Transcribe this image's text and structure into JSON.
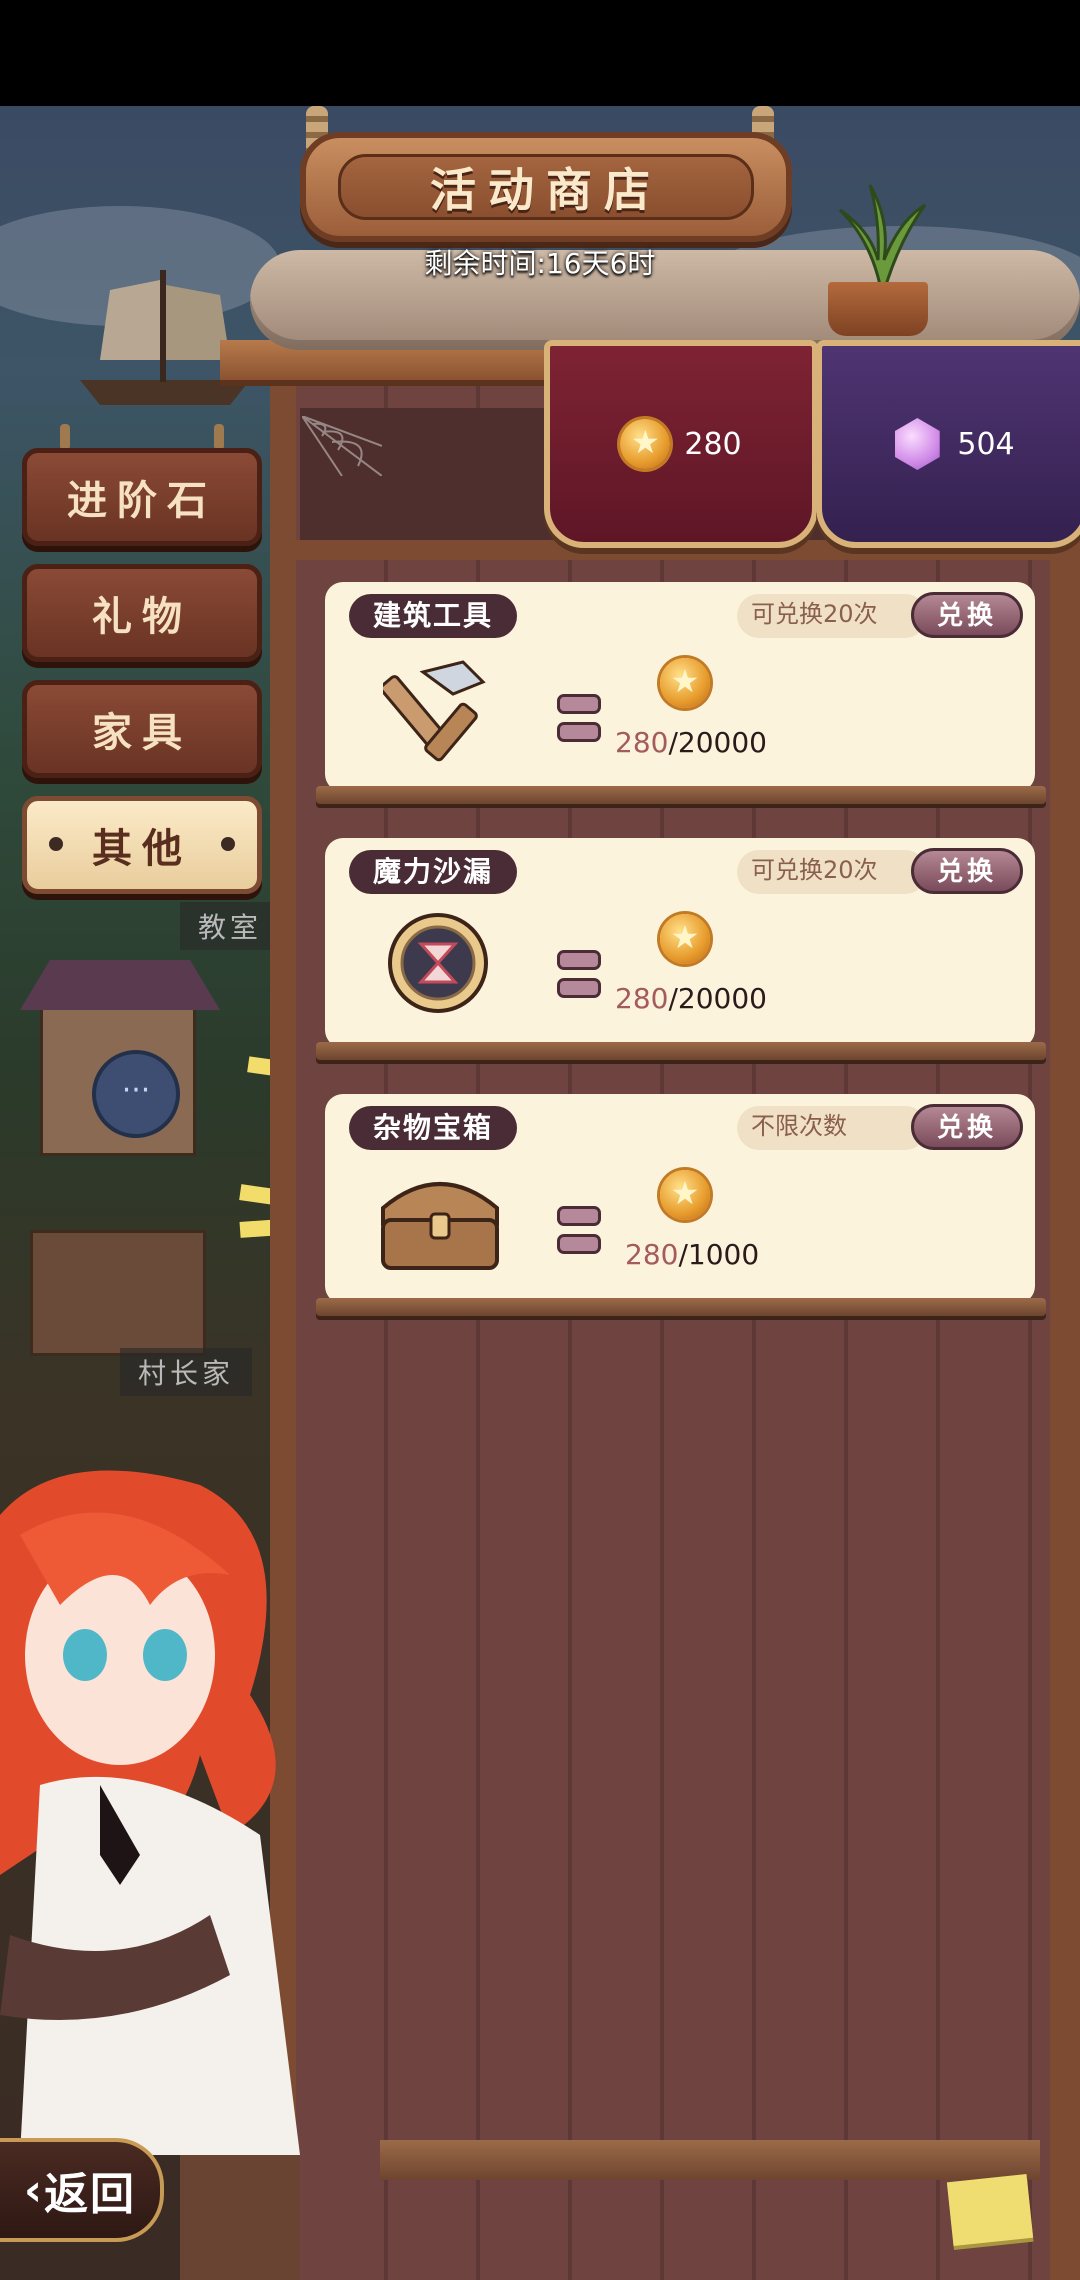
{
  "title": "活动商店",
  "remaining_time": "剩余时间:16天6时",
  "currencies": [
    {
      "icon": "medal-coin-icon",
      "value": "280"
    },
    {
      "icon": "purple-gem-icon",
      "value": "504"
    }
  ],
  "menu": [
    {
      "label": "进阶石",
      "active": false
    },
    {
      "label": "礼物",
      "active": false
    },
    {
      "label": "家具",
      "active": false
    },
    {
      "label": "其他",
      "active": true
    }
  ],
  "map_labels": [
    "教室",
    "村长家"
  ],
  "items": [
    {
      "name": "建筑工具",
      "limit": "可兑换20次",
      "button": "兑换",
      "icon": "hammer-icon",
      "have": "280",
      "cost": "/20000"
    },
    {
      "name": "魔力沙漏",
      "limit": "可兑换20次",
      "button": "兑换",
      "icon": "hourglass-icon",
      "have": "280",
      "cost": "/20000"
    },
    {
      "name": "杂物宝箱",
      "limit": "不限次数",
      "button": "兑换",
      "icon": "treasure-chest-icon",
      "have": "280",
      "cost": "/1000"
    }
  ],
  "back_label": "返回",
  "colors": {
    "accent_red": "#7e2333",
    "accent_purple": "#4f3472",
    "card_bg": "#fcf3dc",
    "tag_bg": "#4a2c36"
  }
}
